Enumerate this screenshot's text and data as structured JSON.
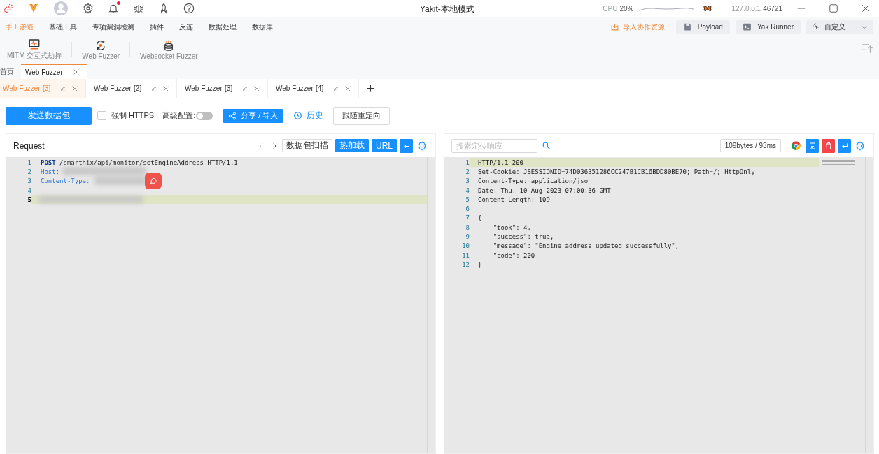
{
  "titlebar": {
    "title": "Yakit-本地模式",
    "notification": true,
    "cpu_label": "CPU",
    "cpu_value": "20%",
    "host": "127.0.0.1",
    "port": "46721"
  },
  "menu": [
    {
      "label": "手工渗透",
      "selected": true
    },
    {
      "label": "基础工具",
      "selected": false
    },
    {
      "label": "专项漏洞检测",
      "selected": false
    },
    {
      "label": "插件",
      "selected": false
    },
    {
      "label": "反连",
      "selected": false
    },
    {
      "label": "数据处理",
      "selected": false
    },
    {
      "label": "数据库",
      "selected": false
    }
  ],
  "actions": {
    "import": "导入协作资源",
    "buttons": [
      {
        "kind": "payload",
        "label": "Payload"
      },
      {
        "kind": "runner",
        "label": "Yak Runner"
      }
    ],
    "custom": "自定义"
  },
  "tools": [
    {
      "kind": "monitor",
      "label": "MITM 交互式劫持"
    },
    {
      "kind": "fuzzer",
      "label": "Web Fuzzer"
    },
    {
      "kind": "socket",
      "label": "Websocket Fuzzer"
    }
  ],
  "page_tabs": [
    {
      "label": "首页",
      "selected": false
    },
    {
      "label": "Web Fuzzer",
      "selected": true
    }
  ],
  "fuzzer_tabs": [
    {
      "label": "Web Fuzzer-[3]",
      "selected": true
    },
    {
      "label": "Web Fuzzer-[2]",
      "selected": false
    },
    {
      "label": "Web Fuzzer-[3]",
      "selected": false
    },
    {
      "label": "Web Fuzzer-[4]",
      "selected": false
    }
  ],
  "toolbar": {
    "send": "发送数据包",
    "force_https": {
      "label": "强制 HTTPS",
      "checked": false
    },
    "advanced": {
      "label": "高级配置:",
      "on": false
    },
    "share": "分享 / 导入",
    "history": "历史",
    "redirect": "跟随重定向"
  },
  "request": {
    "title": "Request",
    "buttons": [
      {
        "kind": "plain",
        "label": "数据包扫描"
      },
      {
        "kind": "primary",
        "label": "热加载"
      },
      {
        "kind": "primary",
        "label": "URL"
      }
    ],
    "lines": [
      {
        "number": "1",
        "highlighted": false,
        "tokens": [
          {
            "kind": "method",
            "text": "POST"
          },
          {
            "kind": "plain",
            "text": " /smarthix/api/monitor/setEngineAddress HTTP/1.1"
          }
        ]
      },
      {
        "number": "2",
        "highlighted": false,
        "tokens": [
          {
            "kind": "key",
            "text": "Host:"
          }
        ]
      },
      {
        "number": "3",
        "highlighted": false,
        "tokens": [
          {
            "kind": "key",
            "text": "Content-Type:"
          }
        ]
      },
      {
        "number": "4",
        "highlighted": false
      },
      {
        "number": "5",
        "highlighted": true
      }
    ]
  },
  "response": {
    "search_placeholder": "搜索定位响应",
    "stats": "109bytes / 93ms",
    "lines": [
      {
        "number": "1",
        "highlighted": true,
        "text": "HTTP/1.1 200"
      },
      {
        "number": "2",
        "highlighted": false,
        "text": "Set-Cookie: JSESSIONID=74D036351286CC247B1CB16BDD80BE70; Path=/; HttpOnly"
      },
      {
        "number": "3",
        "highlighted": false,
        "text": "Content-Type: application/json"
      },
      {
        "number": "4",
        "highlighted": false,
        "text": "Date: Thu, 10 Aug 2023 07:00:36 GMT"
      },
      {
        "number": "5",
        "highlighted": false,
        "text": "Content-Length: 109"
      },
      {
        "number": "6",
        "highlighted": false
      },
      {
        "number": "7",
        "highlighted": false,
        "text": "{"
      },
      {
        "number": "8",
        "highlighted": false,
        "text": "    \"took\": 4,"
      },
      {
        "number": "9",
        "highlighted": false,
        "text": "    \"success\": true,"
      },
      {
        "number": "10",
        "highlighted": false,
        "text": "    \"message\": \"Engine address updated successfully\","
      },
      {
        "number": "11",
        "highlighted": false,
        "text": "    \"code\": 200"
      },
      {
        "number": "12",
        "highlighted": false,
        "text": "}"
      }
    ]
  }
}
